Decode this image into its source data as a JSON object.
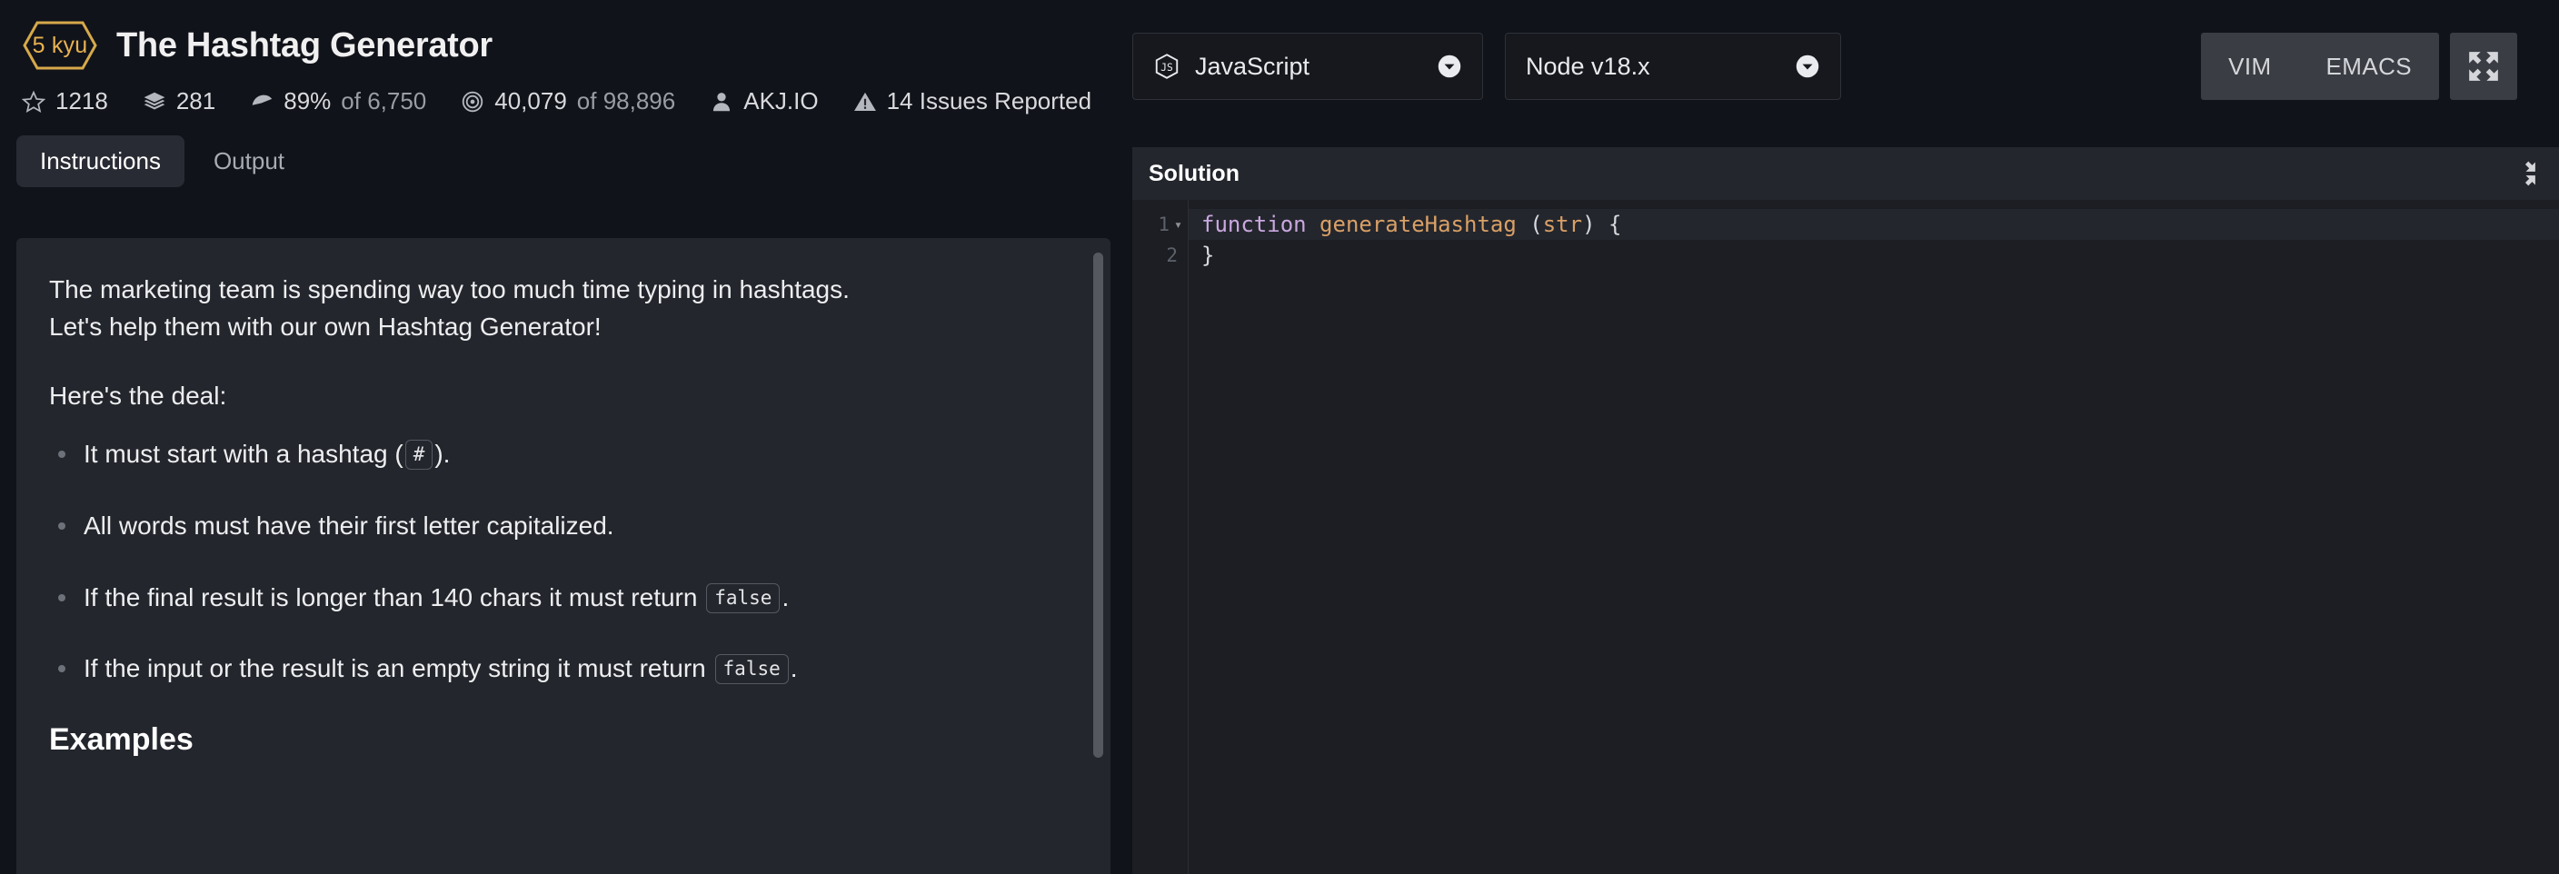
{
  "header": {
    "kyu_badge": "5 kyu",
    "title": "The Hashtag Generator",
    "stats": [
      {
        "icon": "star-icon",
        "value": "1218",
        "suffix": ""
      },
      {
        "icon": "layers-icon",
        "value": "281",
        "suffix": ""
      },
      {
        "icon": "speedometer-icon",
        "value": "89%",
        "suffix": " of 6,750"
      },
      {
        "icon": "target-icon",
        "value": "40,079",
        "suffix": " of 98,896"
      },
      {
        "icon": "person-icon",
        "value": "AKJ.IO",
        "suffix": ""
      },
      {
        "icon": "warning-icon",
        "value": "14 Issues Reported",
        "suffix": ""
      }
    ]
  },
  "tabs": [
    {
      "label": "Instructions",
      "active": true
    },
    {
      "label": "Output",
      "active": false
    }
  ],
  "instructions": {
    "paragraph_1": "The marketing team is spending way too much time typing in hashtags.",
    "paragraph_2": "Let's help them with our own Hashtag Generator!",
    "paragraph_3": "Here's the deal:",
    "rules": [
      {
        "text_before": "It must start with a hashtag (",
        "code": "#",
        "text_after": ")."
      },
      {
        "text_before": "All words must have their first letter capitalized.",
        "code": "",
        "text_after": ""
      },
      {
        "text_before": "If the final result is longer than 140 chars it must return ",
        "code": "false",
        "text_after": "."
      },
      {
        "text_before": "If the input or the result is an empty string it must return ",
        "code": "false",
        "text_after": "."
      }
    ],
    "examples_heading": "Examples"
  },
  "toolbar": {
    "language": {
      "label": "JavaScript",
      "icon": "javascript-icon",
      "caret": "chevron-down-icon"
    },
    "version": {
      "label": "Node v18.x",
      "caret": "chevron-down-icon"
    },
    "editor_modes": [
      {
        "label": "VIM"
      },
      {
        "label": "EMACS"
      }
    ],
    "expand_icon": "expand-arrows-icon"
  },
  "solution": {
    "title": "Solution",
    "collapse_icon": "collapse-arrows-icon",
    "lines": [
      {
        "number": "1",
        "fold": "▾",
        "current": true,
        "tokens": [
          {
            "cls": "tok-kw",
            "text": "function"
          },
          {
            "cls": "tok-pl",
            "text": " "
          },
          {
            "cls": "tok-fn",
            "text": "generateHashtag"
          },
          {
            "cls": "tok-pl",
            "text": " ("
          },
          {
            "cls": "tok-par",
            "text": "str"
          },
          {
            "cls": "tok-pl",
            "text": ") {"
          }
        ]
      },
      {
        "number": "2",
        "fold": "",
        "current": false,
        "tokens": [
          {
            "cls": "tok-pl",
            "text": "}"
          }
        ]
      }
    ]
  },
  "colors": {
    "page_background": "#11131a",
    "panel_background": "#24262d",
    "editor_background": "#1c1e24",
    "badge_gold": "#e8b251",
    "accent_keyword": "#c9a8e0",
    "accent_function": "#d9a066"
  }
}
